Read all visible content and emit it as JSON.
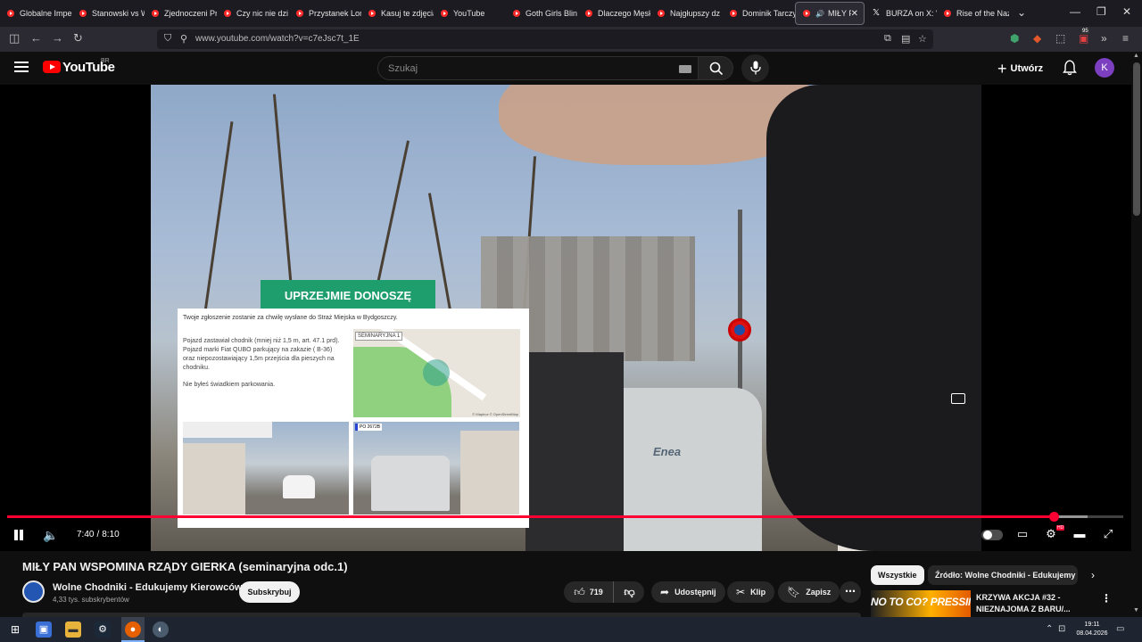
{
  "browser": {
    "tabs": [
      {
        "label": "Globalne Impe",
        "icon": "youtube-icon"
      },
      {
        "label": "Stanowski vs W",
        "icon": "youtube-icon"
      },
      {
        "label": "Zjednoczeni Pr",
        "icon": "youtube-icon"
      },
      {
        "label": "Czy nic nie dzi",
        "icon": "youtube-icon"
      },
      {
        "label": "Przystanek Lon",
        "icon": "youtube-icon"
      },
      {
        "label": "Kasuj te zdjęcia",
        "icon": "youtube-icon"
      },
      {
        "label": "YouTube",
        "icon": "youtube-icon"
      },
      {
        "label": "Goth Girls Blin",
        "icon": "youtube-icon"
      },
      {
        "label": "Dlaczego Męsk",
        "icon": "youtube-icon"
      },
      {
        "label": "Najgłupszy dz",
        "icon": "youtube-icon"
      },
      {
        "label": "Dominik Tarczy",
        "icon": "youtube-icon"
      },
      {
        "label": "MIŁY PA",
        "icon": "youtube-icon",
        "active": true,
        "audio": true
      },
      {
        "label": "BURZA on X: \"",
        "icon": "x-icon"
      },
      {
        "label": "Rise of the Naz",
        "icon": "youtube-icon"
      }
    ],
    "url": "www.youtube.com/watch?v=c7eJsc7t_1E"
  },
  "header": {
    "logo_text": "YouTube",
    "country_code": "BR",
    "search_placeholder": "Szukaj",
    "create_label": "Utwórz",
    "avatar_letter": "K"
  },
  "player": {
    "overlay": {
      "badge": "UPRZEJMIE DONOSZĘ",
      "intro": "Twoje zgłoszenie zostanie za chwilę wysłane do Straż Miejska w Bydgoszczy.",
      "description": "Pojazd zastawiał chodnik (mniej niż 1,5 m, art. 47.1 prd). Pojazd marki Fiat QUBO parkujący na zakazie ( B-36) oraz niepozostawiający 1,5m przejścia dla pieszych na chodniku.",
      "note": "Nie byłeś świadkiem parkowania.",
      "map_label": "SEMINARYJNA 1",
      "map_attribution": "© Mapbox © OpenStreetMap",
      "photo_tag": "PO 2672B"
    },
    "van_brand": "Enea",
    "time_current": "7:40",
    "time_total": "8:10",
    "time_separator": "/",
    "progress_played": 0.938,
    "progress_loaded": 0.968,
    "hd_badge": "HD"
  },
  "video": {
    "title": "MIŁY PAN WSPOMINA RZĄDY GIERKA (seminaryjna odc.1)",
    "channel_name": "Wolne Chodniki - Edukujemy Kierowców",
    "subscribers": "4,33 tys. subskrybentów",
    "subscribe_label": "Subskrybuj",
    "likes": "719",
    "share_label": "Udostępnij",
    "clip_label": "Klip",
    "save_label": "Zapisz"
  },
  "sidebar": {
    "chips": [
      "Wszystkie",
      "Źródło: Wolne Chodniki - Edukujemy K"
    ],
    "recommendation": {
      "thumb_text": "NO TO CO? PRESSING!",
      "title": "KRZYWA AKCJA #32 - NIEZNAJOMA Z BARU/..."
    }
  },
  "taskbar": {
    "time": "19:11",
    "date": "08.04.2026",
    "notif_badge": "95"
  },
  "colors": {
    "yt_red": "#ff0000",
    "progress_red": "#ff0033",
    "overlay_green": "#1e9d6d",
    "avatar_purple": "#7c3fbf"
  }
}
